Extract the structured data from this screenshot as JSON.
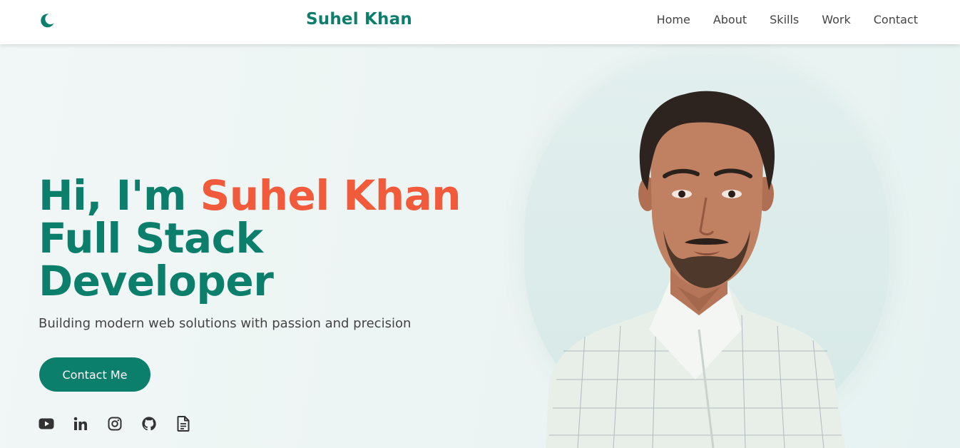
{
  "nav": {
    "brand": "Suhel Khan",
    "theme_icon": "moon-icon",
    "links": [
      "Home",
      "About",
      "Skills",
      "Work",
      "Contact"
    ]
  },
  "hero": {
    "greeting": "Hi, I'm ",
    "name": "Suhel Khan",
    "role_line1": "Full Stack",
    "role_line2": "Developer",
    "subtitle": "Building modern web solutions with passion and precision",
    "cta": "Contact Me"
  },
  "socials": [
    "youtube-icon",
    "linkedin-icon",
    "instagram-icon",
    "github-icon",
    "resume-document-icon"
  ],
  "colors": {
    "primary": "#0c7e6c",
    "accent": "#f25a3c",
    "text": "#444444"
  }
}
